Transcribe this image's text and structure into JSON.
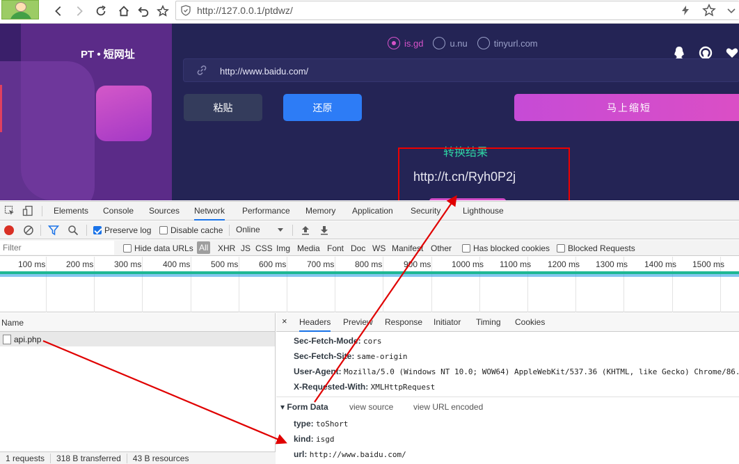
{
  "browser": {
    "url": "http://127.0.0.1/ptdwz/"
  },
  "site": {
    "brand": "PT • 短网址",
    "services": [
      {
        "label": "is.gd",
        "selected": true
      },
      {
        "label": "u.nu",
        "selected": false
      },
      {
        "label": "tinyurl.com",
        "selected": false
      }
    ],
    "input_value": "http://www.baidu.com/",
    "paste_label": "粘贴",
    "restore_label": "还原",
    "shorten_label": "马上缩短",
    "result_title": "转换结果",
    "result_url": "http://t.cn/Ryh0P2j",
    "colors": {
      "accent": "#d653c9",
      "result_title": "#2fd6a4",
      "restore": "#2d7cf6",
      "annotation": "#e00000"
    }
  },
  "devtools": {
    "tabs": [
      "Elements",
      "Console",
      "Sources",
      "Network",
      "Performance",
      "Memory",
      "Application",
      "Security",
      "Lighthouse"
    ],
    "active_tab": "Network",
    "toolbar": {
      "preserve_log": "Preserve log",
      "disable_cache": "Disable cache",
      "throttle": "Online"
    },
    "filter": {
      "placeholder": "Filter",
      "hide_data_urls": "Hide data URLs",
      "types": [
        "All",
        "XHR",
        "JS",
        "CSS",
        "Img",
        "Media",
        "Font",
        "Doc",
        "WS",
        "Manifest",
        "Other"
      ],
      "has_blocked_cookies": "Has blocked cookies",
      "blocked_requests": "Blocked Requests"
    },
    "timeline_ticks": [
      "100 ms",
      "200 ms",
      "300 ms",
      "400 ms",
      "500 ms",
      "600 ms",
      "700 ms",
      "800 ms",
      "900 ms",
      "1000 ms",
      "1100 ms",
      "1200 ms",
      "1300 ms",
      "1400 ms",
      "1500 ms",
      "1"
    ],
    "name_header": "Name",
    "requests": [
      "api.php"
    ],
    "status": [
      "1 requests",
      "318 B transferred",
      "43 B resources"
    ],
    "detail_tabs": [
      "Headers",
      "Preview",
      "Response",
      "Initiator",
      "Timing",
      "Cookies"
    ],
    "close_label": "×",
    "headers": [
      {
        "k": "Sec-Fetch-Mode:",
        "v": "cors"
      },
      {
        "k": "Sec-Fetch-Site:",
        "v": "same-origin"
      },
      {
        "k": "User-Agent:",
        "v": "Mozilla/5.0 (Windows NT 10.0; WOW64) AppleWebKit/537.36 (KHTML, like Gecko) Chrome/86."
      },
      {
        "k": "X-Requested-With:",
        "v": "XMLHttpRequest"
      }
    ],
    "form_data": {
      "title": "Form Data",
      "view_source": "view source",
      "view_url_encoded": "view URL encoded",
      "fields": [
        {
          "k": "type:",
          "v": "toShort"
        },
        {
          "k": "kind:",
          "v": "isgd"
        },
        {
          "k": "url:",
          "v": "http://www.baidu.com/"
        }
      ]
    }
  }
}
